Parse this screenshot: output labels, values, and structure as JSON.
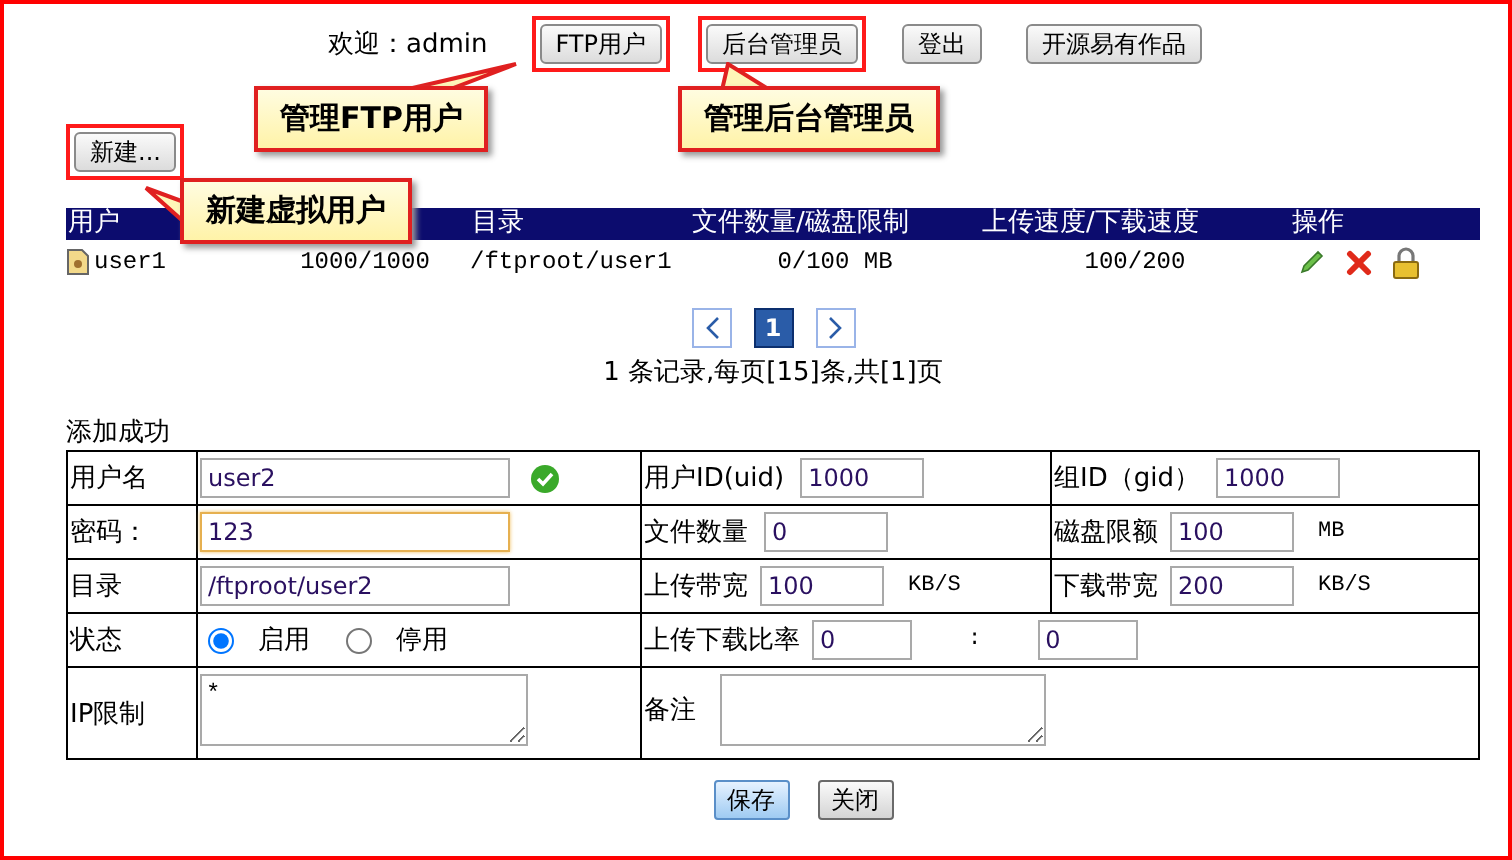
{
  "top_bar": {
    "welcome": "欢迎：admin",
    "buttons": [
      {
        "label": "FTP用户",
        "highlighted": true
      },
      {
        "label": "后台管理员",
        "highlighted": true
      },
      {
        "label": "登出",
        "highlighted": false
      },
      {
        "label": "开源易有作品",
        "highlighted": false
      }
    ]
  },
  "new_button": {
    "label": "新建...",
    "highlighted": true
  },
  "callouts": [
    {
      "text": "管理FTP用户"
    },
    {
      "text": "管理后台管理员"
    },
    {
      "text": "新建虚拟用户"
    }
  ],
  "users_table": {
    "columns": {
      "user": "用户",
      "directory": "目录",
      "files_quota": "文件数量/磁盘限制",
      "speed": "上传速度/下载速度",
      "actions": "操作"
    },
    "rows": [
      {
        "user": "user1",
        "column_2": "1000/1000",
        "directory": "/ftproot/user1",
        "files_quota": "0/100 MB",
        "speed": "100/200"
      }
    ]
  },
  "pagination": {
    "pages": [
      {
        "label": "1",
        "selected": true
      }
    ],
    "summary": "1 条记录,每页[15]条,共[1]页"
  },
  "form": {
    "message": "添加成功",
    "username": {
      "label": "用户名",
      "value": "user2",
      "valid": true
    },
    "uid": {
      "label": "用户ID(uid)",
      "value": "1000"
    },
    "gid": {
      "label": "组ID（gid）",
      "value": "1000"
    },
    "password": {
      "label": "密码：",
      "value": "123",
      "focused": true
    },
    "file_count": {
      "label": "文件数量",
      "value": "0"
    },
    "disk_quota": {
      "label": "磁盘限额",
      "value": "100",
      "unit": "MB"
    },
    "directory": {
      "label": "目录",
      "value": "/ftproot/user2"
    },
    "upload_bandwidth": {
      "label": "上传带宽",
      "value": "100",
      "unit": "KB/S"
    },
    "download_bandwidth": {
      "label": "下载带宽",
      "value": "200",
      "unit": "KB/S"
    },
    "status": {
      "label": "状态",
      "options": [
        {
          "label": "启用",
          "selected": true
        },
        {
          "label": "停用",
          "selected": false
        }
      ]
    },
    "ratio": {
      "label": "上传下载比率",
      "upload": "0",
      "separator": ":",
      "download": "0"
    },
    "ip_limit": {
      "label": "IP限制",
      "value": "*"
    },
    "note": {
      "label": "备注"
    },
    "buttons": [
      {
        "label": "保存",
        "kind": "primary"
      },
      {
        "label": "关闭",
        "kind": "default"
      }
    ]
  }
}
